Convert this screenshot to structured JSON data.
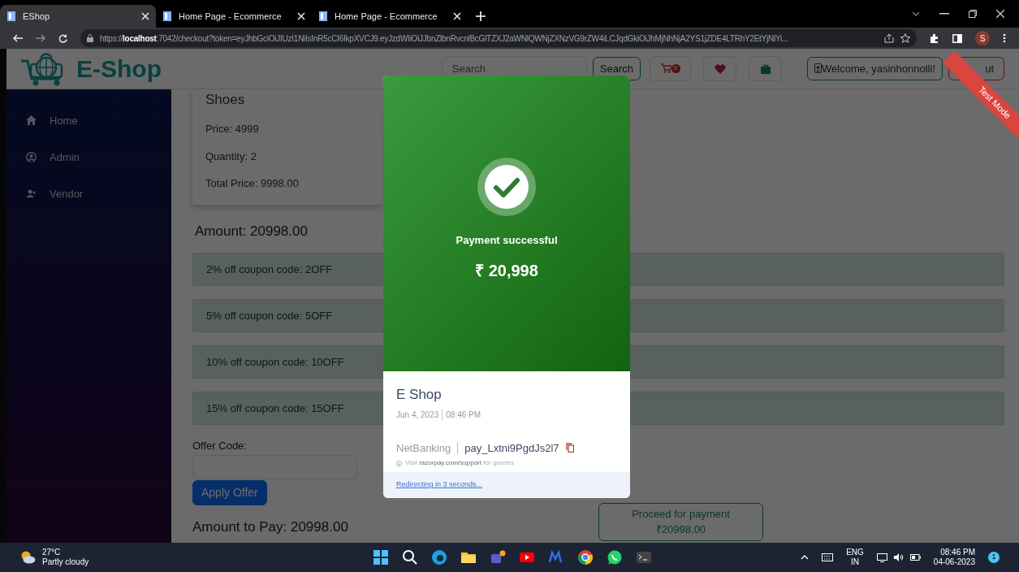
{
  "browser": {
    "tabs": [
      {
        "title": "EShop",
        "selected": true
      },
      {
        "title": "Home Page - Ecommerce",
        "selected": false
      },
      {
        "title": "Home Page - Ecommerce",
        "selected": false
      }
    ],
    "url": "https://**localhost**:7042/checkout?token=eyJhbGciOiJIUzI1NiIsInR5cCI6IkpXVCJ9.eyJzdWIiOiJJbnZlbnRvcnlBcGlTZXJ2aWNlQWNjZXNzVG9rZW4iLCJqdGkiOiJhMjNhNjA2YS1jZDE4LTRhY2EtYjNlYi...",
    "profile_initial": "S"
  },
  "navbar": {
    "brand": "E-Shop",
    "search_placeholder": "Search",
    "search_button": "Search",
    "cart_count": "5",
    "welcome": "Welcome, yasinhonnolli!",
    "logout": "ut"
  },
  "ribbon": "Test Mode",
  "sidebar": {
    "items": [
      {
        "label": "Home"
      },
      {
        "label": "Admin"
      },
      {
        "label": "Vendor"
      }
    ]
  },
  "cart_item": {
    "name": "Shoes",
    "price": "Price: 4999",
    "quantity": "Quantity: 2",
    "total": "Total Price: 9998.00"
  },
  "amount": "Amount: 20998.00",
  "coupons": [
    "2% off coupon code: 2OFF",
    "5% off coupon code: 5OFF",
    "10% off coupon code: 10OFF",
    "15% off coupon code: 15OFF"
  ],
  "offer": {
    "label": "Offer Code:",
    "button": "Apply Offer"
  },
  "amount_to_pay": "Amount to Pay: 20998.00",
  "proceed": {
    "label": "Proceed for payment",
    "amount": "₹20998.00"
  },
  "payment_dialog": {
    "status": "Payment successful",
    "amount": "₹ 20,998",
    "merchant": "E Shop",
    "date": "Jun 4, 2023",
    "time": "08:46 PM",
    "method": "NetBanking",
    "payment_id": "pay_Lxtni9PgdJs2l7",
    "support_prefix": "Visit",
    "support_link": "razorpay.com/support",
    "support_suffix": "for queries",
    "redirect": "Redirecting in 3 seconds..."
  },
  "taskbar": {
    "temperature": "27°C",
    "weather": "Partly cloudy",
    "language": "ENG",
    "region": "IN",
    "time": "08:46 PM",
    "date": "04-06-2023",
    "notifications": "1"
  }
}
